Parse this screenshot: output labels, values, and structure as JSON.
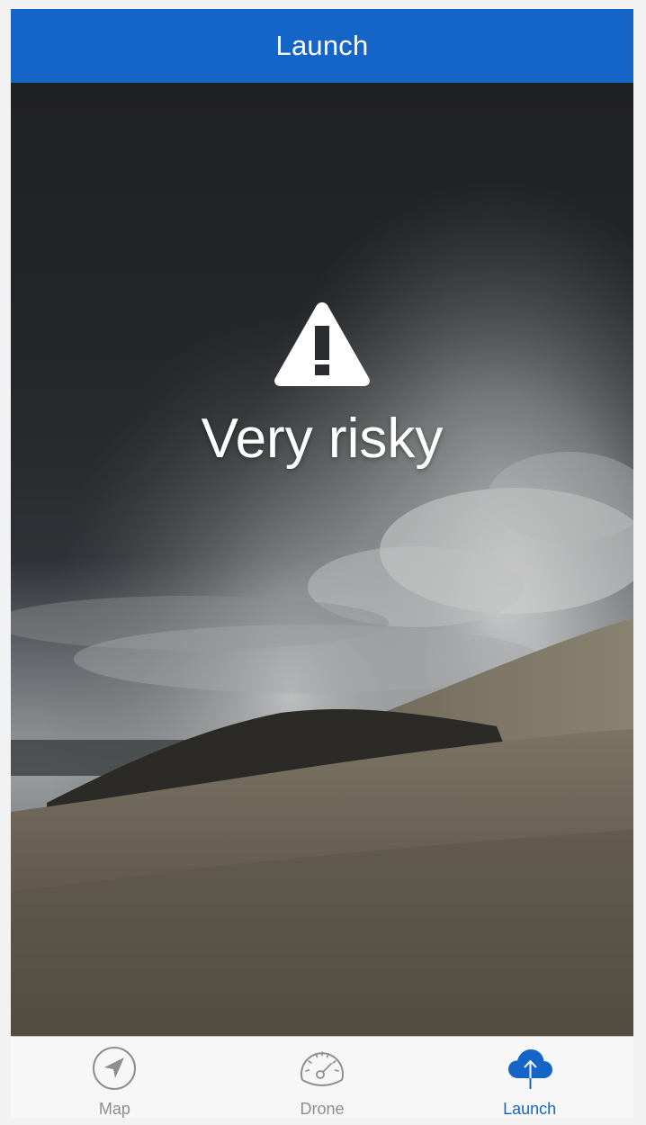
{
  "app": {
    "title": "Launch"
  },
  "risk": {
    "level_text": "Very risky",
    "icon": "warning-triangle-icon"
  },
  "tabs": [
    {
      "label": "Map",
      "icon": "navigation-arrow-icon",
      "active": false
    },
    {
      "label": "Drone",
      "icon": "speedometer-icon",
      "active": false
    },
    {
      "label": "Launch",
      "icon": "cloud-upload-icon",
      "active": true
    }
  ],
  "colors": {
    "accent": "#1565c8",
    "inactive_tab": "#8e8e8e",
    "navbar_text": "#ffffff"
  }
}
